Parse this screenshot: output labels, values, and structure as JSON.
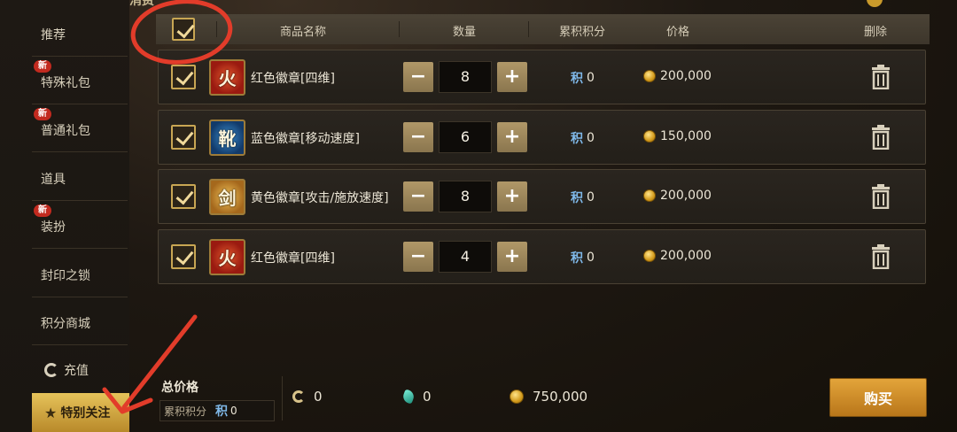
{
  "header": {
    "title_partial": "逐位消费"
  },
  "sidebar": {
    "items": [
      {
        "label": "推荐",
        "badge": ""
      },
      {
        "label": "特殊礼包",
        "badge": "新"
      },
      {
        "label": "普通礼包",
        "badge": "新"
      },
      {
        "label": "道具",
        "badge": ""
      },
      {
        "label": "装扮",
        "badge": "新"
      },
      {
        "label": "封印之锁",
        "badge": ""
      },
      {
        "label": "积分商城",
        "badge": ""
      },
      {
        "label": "充值",
        "badge": ""
      },
      {
        "label": "特别关注",
        "badge": ""
      }
    ]
  },
  "table": {
    "headers": {
      "name": "商品名称",
      "quantity": "数量",
      "points": "累积积分",
      "price": "价格",
      "delete": "删除"
    },
    "rows": [
      {
        "name": "红色徽章[四维]",
        "qty": "8",
        "points": "0",
        "price": "200,000",
        "icon": "red-badge-icon",
        "checked": true
      },
      {
        "name": "蓝色徽章[移动速度]",
        "qty": "6",
        "points": "0",
        "price": "150,000",
        "icon": "blue-badge-icon",
        "checked": true
      },
      {
        "name": "黄色徽章[攻击/施放速度]",
        "qty": "8",
        "points": "0",
        "price": "200,000",
        "icon": "yellow-badge-icon",
        "checked": true
      },
      {
        "name": "红色徽章[四维]",
        "qty": "4",
        "points": "0",
        "price": "200,000",
        "icon": "red-badge-icon",
        "checked": true
      }
    ],
    "minus": "−",
    "plus": "+",
    "points_glyph": "积"
  },
  "footer": {
    "total_label": "总价格",
    "acc_label": "累积积分",
    "acc_value": "0",
    "c_currency": "0",
    "gem_currency": "0",
    "gold_total": "750,000",
    "buy_label": "购买"
  },
  "colors": {
    "accent_gold": "#c8a653",
    "buy_button": "#e3a43a",
    "new_badge": "#c22a1f",
    "annotation_red": "#e23c2a"
  }
}
